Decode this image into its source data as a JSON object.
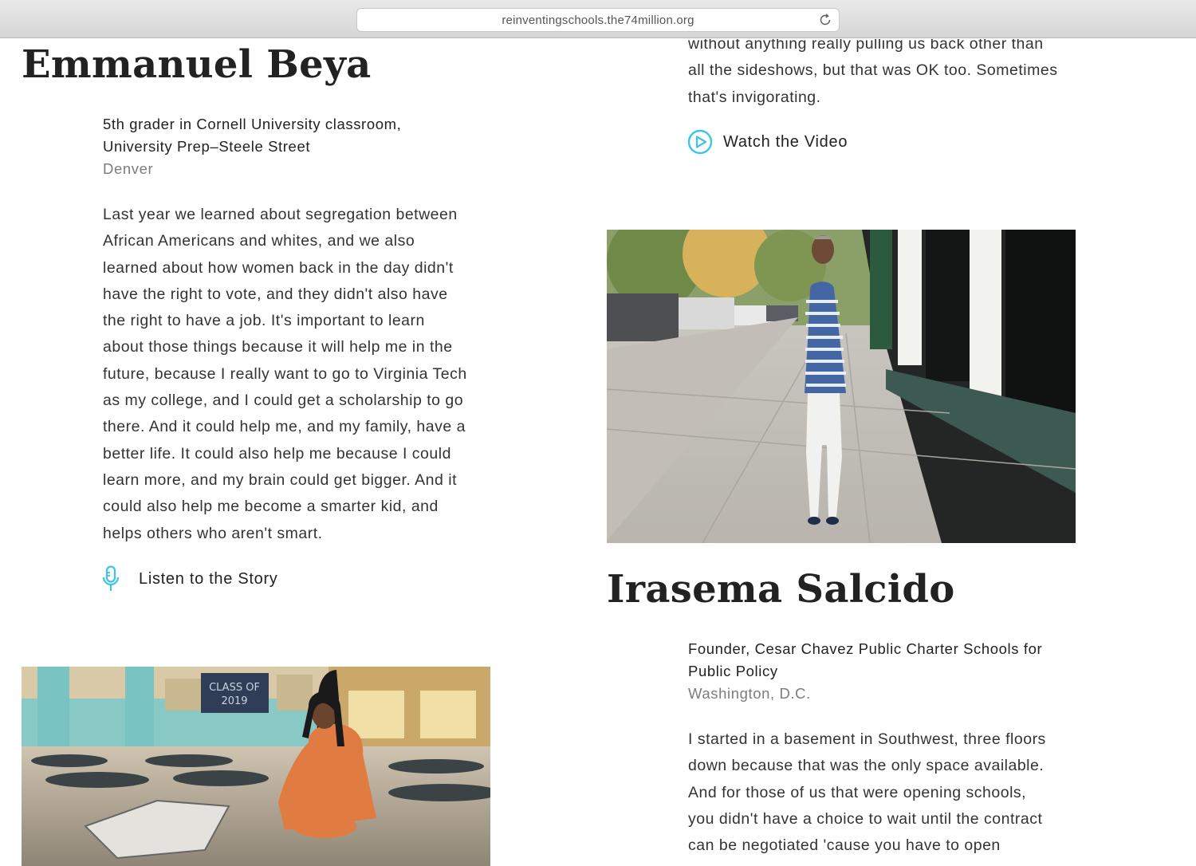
{
  "browser": {
    "url": "reinventingschools.the74million.org"
  },
  "profiles": {
    "beya": {
      "name": "Emmanuel Beya",
      "role_line1": "5th grader in Cornell University classroom,",
      "role_line2": "University Prep–Steele Street",
      "location": "Denver",
      "quote_lines": [
        "Last year we learned about segregation between",
        "African Americans and whites, and we also",
        "learned about how women back in the day didn't",
        "have the right to vote, and they didn't also have",
        "the right to have a job. It's important to learn",
        "about those things because it will help me in the",
        "future, because I really want to go to Virginia Tech",
        "as my college, and I could get a scholarship to go",
        "there. And it could help me, and my family, have a",
        "better life. It could also help me because I could",
        "learn more, and my brain could get bigger. And it",
        "could also help me become a smarter kid, and",
        "helps others who aren't smart."
      ],
      "action_label": "Listen to the Story",
      "action_icon": "microphone-icon"
    },
    "previous": {
      "quote_tail_lines": [
        "without anything really pulling us back other than",
        "all the sideshows, but that was OK too. Sometimes",
        "that's invigorating."
      ],
      "action_label": "Watch the Video",
      "action_icon": "play-circle-icon"
    },
    "salcido": {
      "name": "Irasema Salcido",
      "role_line1": "Founder, Cesar Chavez Public Charter Schools for",
      "role_line2": "Public Policy",
      "location": "Washington, D.C.",
      "quote_lines": [
        "I started in a basement in Southwest, three floors",
        "down because that was the only space available.",
        "And for those of us that were opening schools,",
        "you didn't have a choice to wait until the contract",
        "can be negotiated 'cause you have to open"
      ]
    }
  },
  "photo_banner": {
    "text_line1": "CLASS OF",
    "text_line2": "2019"
  },
  "colors": {
    "accent": "#3ec3e8",
    "text": "#222222",
    "muted": "#7c7c7c"
  }
}
